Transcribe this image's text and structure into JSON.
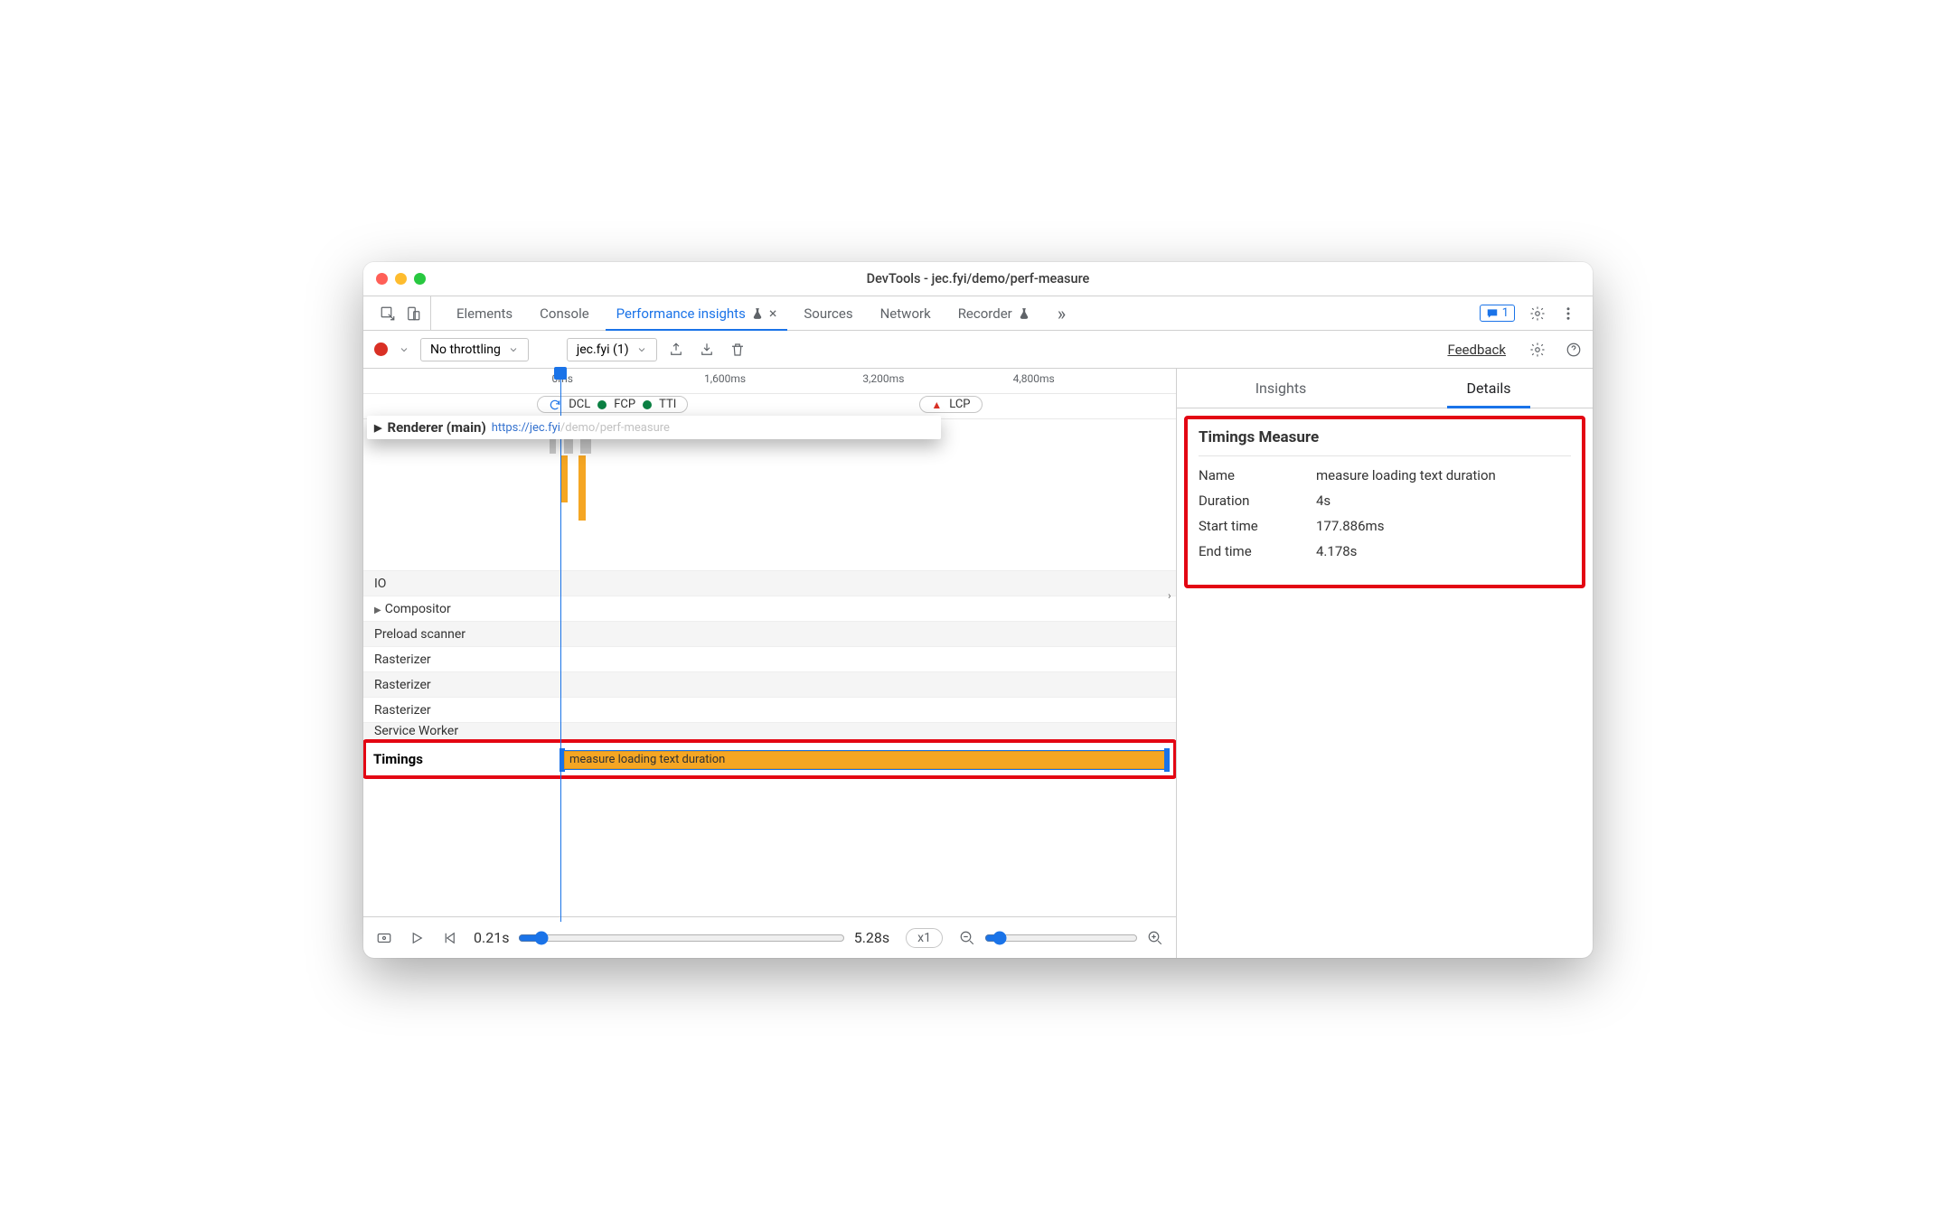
{
  "window": {
    "title": "DevTools - jec.fyi/demo/perf-measure"
  },
  "tabs": {
    "items": [
      "Elements",
      "Console",
      "Performance insights",
      "Sources",
      "Network",
      "Recorder"
    ],
    "active_index": 2,
    "close_visible_index": 2,
    "overflow_count": "",
    "issues_badge": "1"
  },
  "toolbar": {
    "throttle_label": "No throttling",
    "capture_label": "jec.fyi (1)",
    "feedback": "Feedback"
  },
  "ruler": {
    "ticks": [
      {
        "label": "0ms",
        "pct": 24.5
      },
      {
        "label": "1,600ms",
        "pct": 44.5
      },
      {
        "label": "3,200ms",
        "pct": 64
      },
      {
        "label": "4,800ms",
        "pct": 82.5
      }
    ]
  },
  "metrics": {
    "group1": [
      "DCL",
      "FCP",
      "TTI"
    ],
    "lcp": "LCP"
  },
  "overlay": {
    "renderer": "Renderer (main)",
    "url_prefix": "https://jec.fyi",
    "url_path": "/demo/perf-measure"
  },
  "tracks": {
    "main": "Main",
    "io": "IO",
    "compositor": "Compositor",
    "preload": "Preload scanner",
    "raster1": "Rasterizer",
    "raster2": "Rasterizer",
    "raster3": "Rasterizer",
    "sw": "Service Worker",
    "timings": "Timings",
    "measure_label": "measure loading text duration"
  },
  "right": {
    "tabs": [
      "Insights",
      "Details"
    ],
    "active": 1,
    "header": "Timings Measure",
    "rows": [
      {
        "k": "Name",
        "v": "measure loading text duration"
      },
      {
        "k": "Duration",
        "v": "4s"
      },
      {
        "k": "Start time",
        "v": "177.886ms"
      },
      {
        "k": "End time",
        "v": "4.178s"
      }
    ]
  },
  "footer": {
    "start": "0.21s",
    "end": "5.28s",
    "speed": "x1"
  }
}
